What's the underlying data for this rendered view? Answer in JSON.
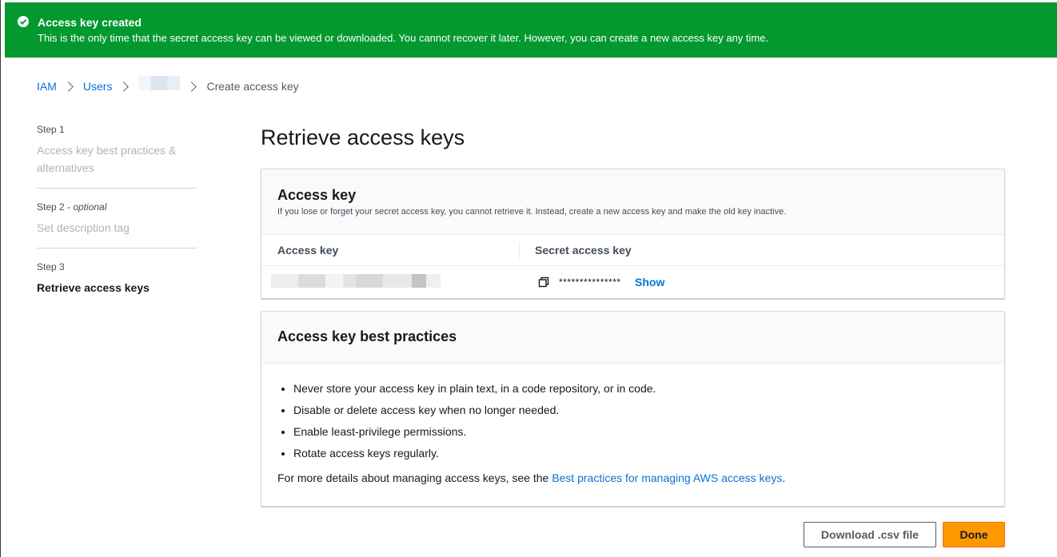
{
  "flash": {
    "title": "Access key created",
    "message": "This is the only time that the secret access key can be viewed or downloaded. You cannot recover it later. However, you can create a new access key any time.",
    "icon": "check-circle-icon",
    "color": "#03992f"
  },
  "breadcrumb": {
    "items": [
      "IAM",
      "Users"
    ],
    "current": "Create access key"
  },
  "steps": [
    {
      "label": "Step 1",
      "optional": "",
      "title": "Access key best practices & alternatives"
    },
    {
      "label": "Step 2 - ",
      "optional": "optional",
      "title": "Set description tag"
    },
    {
      "label": "Step 3",
      "optional": "",
      "title": "Retrieve access keys"
    }
  ],
  "page": {
    "title": "Retrieve access keys"
  },
  "access_key_panel": {
    "title": "Access key",
    "description": "If you lose or forget your secret access key, you cannot retrieve it. Instead, create a new access key and make the old key inactive.",
    "columns": [
      "Access key",
      "Secret access key"
    ],
    "secret_masked": "***************",
    "show_label": "Show",
    "copy_icon": "copy-icon"
  },
  "best_practices_panel": {
    "title": "Access key best practices",
    "items": [
      "Never store your access key in plain text, in a code repository, or in code.",
      "Disable or delete access key when no longer needed.",
      "Enable least-privilege permissions.",
      "Rotate access keys regularly."
    ],
    "footer_prefix": "For more details about managing access keys, see the ",
    "footer_link": "Best practices for managing AWS access keys",
    "footer_suffix": "."
  },
  "actions": {
    "download_label": "Download .csv file",
    "done_label": "Done",
    "primary_color": "#ff9900",
    "link_color": "#0972d3"
  }
}
